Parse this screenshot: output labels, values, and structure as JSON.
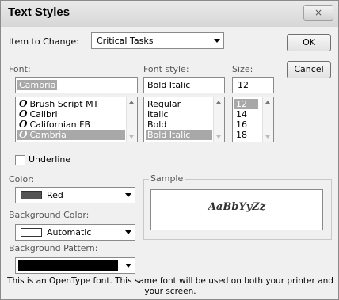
{
  "dialog": {
    "title": "Text Styles",
    "close_glyph": "×",
    "ok_label": "OK",
    "cancel_label": "Cancel"
  },
  "item_to_change": {
    "label": "Item to Change:",
    "value": "Critical Tasks"
  },
  "font": {
    "label": "Font:",
    "value": "Cambria",
    "items": [
      {
        "name": "Brush Script MT",
        "selected": false
      },
      {
        "name": "Calibri",
        "selected": false
      },
      {
        "name": "Californian FB",
        "selected": false
      },
      {
        "name": "Cambria",
        "selected": true
      }
    ],
    "type_icon_glyph": "O"
  },
  "font_style": {
    "label": "Font style:",
    "value": "Bold Italic",
    "items": [
      "Regular",
      "Italic",
      "Bold",
      "Bold Italic"
    ],
    "selected_index": 3
  },
  "size": {
    "label": "Size:",
    "value": "12",
    "items": [
      "12",
      "14",
      "16",
      "18"
    ],
    "selected_index": 0
  },
  "underline": {
    "label": "Underline",
    "checked": false
  },
  "color": {
    "label": "Color:",
    "value": "Red",
    "swatch": "#555555"
  },
  "background_color": {
    "label": "Background Color:",
    "value": "Automatic",
    "swatch": "#ffffff"
  },
  "background_pattern": {
    "label": "Background Pattern:",
    "swatch": "#000000"
  },
  "sample": {
    "label": "Sample",
    "text": "AaBbYyZz"
  },
  "info_text": "This is an OpenType font. This same font will be used on both your printer and your screen."
}
